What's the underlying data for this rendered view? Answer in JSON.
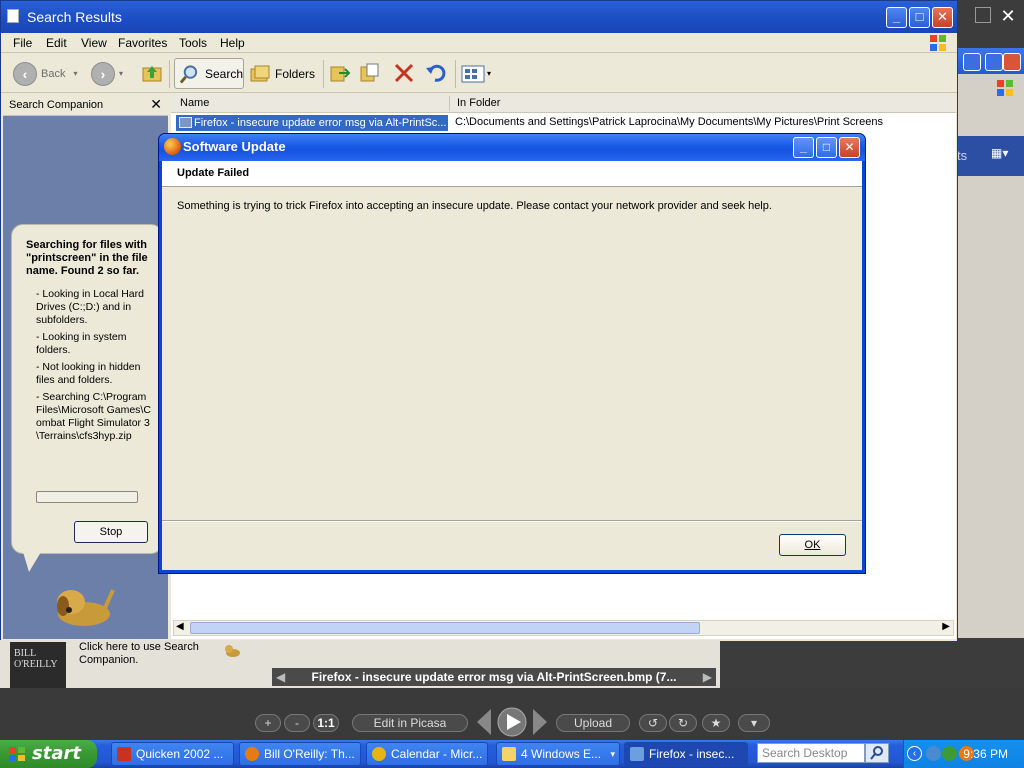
{
  "explorer": {
    "title": "Search Results",
    "menu": [
      "File",
      "Edit",
      "View",
      "Favorites",
      "Tools",
      "Help"
    ],
    "toolbar": {
      "back": "Back",
      "search": "Search",
      "folders": "Folders"
    },
    "sidebar": {
      "title": "Search Companion",
      "status": "Searching for files with \"printscreen\" in the file name.  Found 2 so far.",
      "items": [
        "- Looking in Local Hard Drives (C:;D:) and in subfolders.",
        "- Looking in system folders.",
        "- Not looking in hidden files and folders.",
        "- Searching C:\\Program Files\\Microsoft Games\\Combat Flight Simulator 3\\Terrains\\cfs3hyp.zip"
      ],
      "stop_label": "Stop"
    },
    "columns": {
      "name": "Name",
      "folder": "In Folder"
    },
    "rows": [
      {
        "name": "Firefox - insecure update error msg via Alt-PrintSc...",
        "folder": "C:\\Documents and Settings\\Patrick Laprocina\\My Documents\\My Pictures\\Print Screens"
      }
    ],
    "row2_tail": "s"
  },
  "background_window": {
    "band_text": "ts"
  },
  "lower": {
    "book_text": "BILL O'REILLY",
    "companion_text": "Click here to use Search Companion.",
    "caption": "Firefox - insecure update error msg via Alt-PrintScreen.bmp (7..."
  },
  "picasa": {
    "plus": "+",
    "minus": "-",
    "ratio": "1:1",
    "edit": "Edit in Picasa",
    "upload": "Upload"
  },
  "dialog": {
    "title": "Software Update",
    "header": "Update Failed",
    "message": "Something is trying to trick Firefox into accepting an insecure update. Please contact your network provider and seek help.",
    "ok_label": "OK"
  },
  "taskbar": {
    "start": "start",
    "tasks": [
      {
        "label": "Quicken 2002 ...",
        "color": "#c8321e"
      },
      {
        "label": "Bill O'Reilly: Th...",
        "color": "#e87a14"
      },
      {
        "label": "Calendar - Micr...",
        "color": "#e8b414"
      },
      {
        "label": "4 Windows E...",
        "color": "#f4d36a"
      },
      {
        "label": "Firefox - insec...",
        "color": "#6aa0e0"
      }
    ],
    "search_placeholder": "Search Desktop",
    "clock": "9:36 PM"
  }
}
